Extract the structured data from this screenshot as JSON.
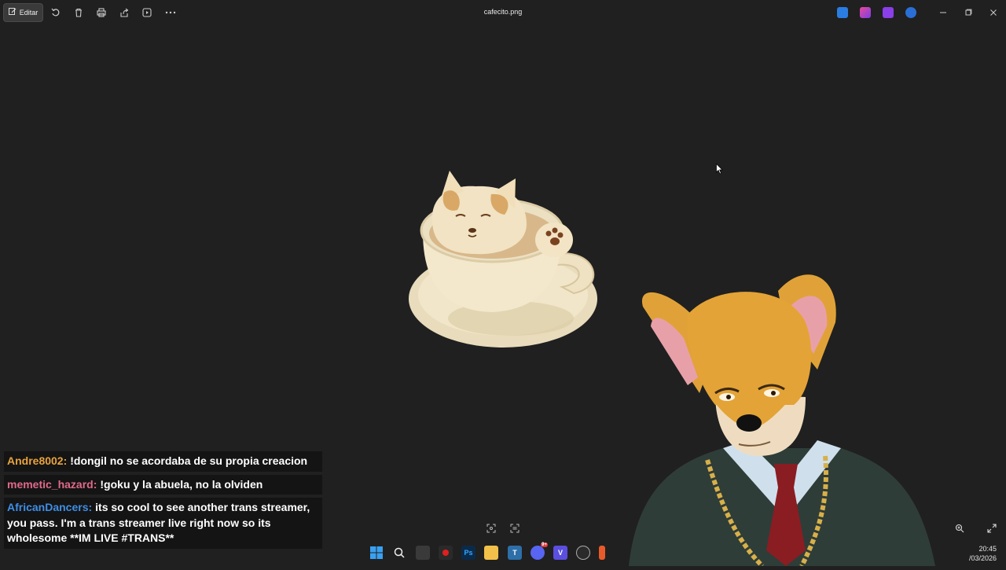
{
  "toolbar": {
    "edit_label": "Editar",
    "title": "cafecito.png"
  },
  "chat": [
    {
      "user": "Andre8002:",
      "color": "#e8a33d",
      "text": "!dongil no se acordaba de su propia creacion"
    },
    {
      "user": "memetic_hazard:",
      "color": "#e06a8a",
      "text": "!goku y la abuela, no la olviden"
    },
    {
      "user": "AfricanDancers:",
      "color": "#3f8ee6",
      "text": "its so cool to see another trans streamer, you pass. I'm a trans streamer live right now so its wholesome **IM LIVE #TRANS**"
    }
  ],
  "taskbar": {
    "time": "20:45",
    "date": "/03/2026",
    "discord_badge": "9+"
  },
  "icons": [
    "edit-icon",
    "rotate-icon",
    "delete-icon",
    "print-icon",
    "share-icon",
    "slideshow-icon",
    "more-icon",
    "minimize-icon",
    "maximize-icon",
    "close-icon",
    "zoom-in-icon",
    "fullscreen-icon",
    "windows-start-icon",
    "search-icon"
  ]
}
